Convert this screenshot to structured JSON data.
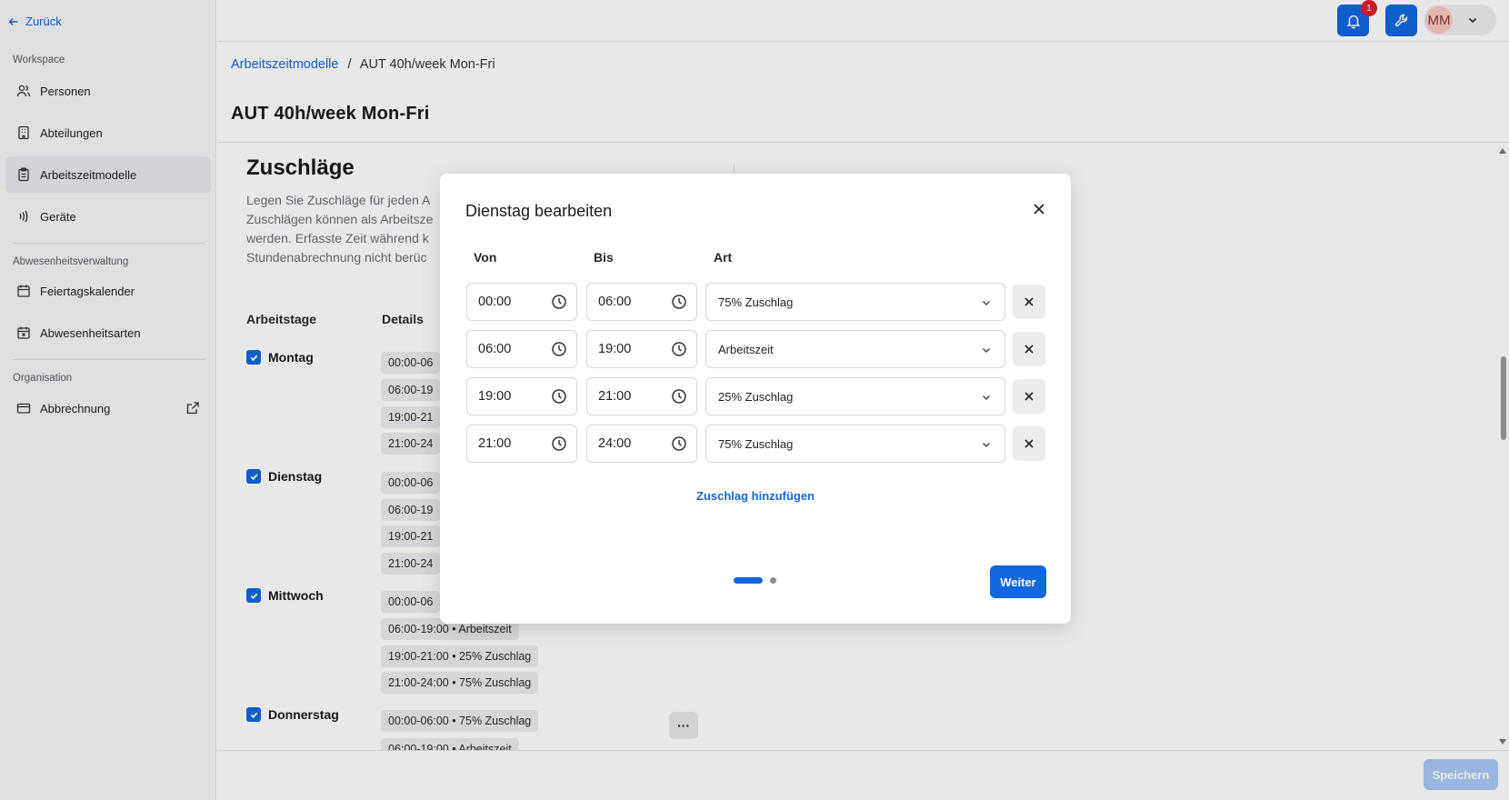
{
  "sidebar": {
    "back_label": "Zurück",
    "sections": [
      {
        "title": "Workspace"
      },
      {
        "title": "Abwesenheitsverwaltung"
      },
      {
        "title": "Organisation"
      }
    ],
    "items": [
      {
        "label": "Personen",
        "icon": "users-icon"
      },
      {
        "label": "Abteilungen",
        "icon": "building-icon"
      },
      {
        "label": "Arbeitszeitmodelle",
        "icon": "clipboard-icon",
        "active": true
      },
      {
        "label": "Geräte",
        "icon": "nfc-icon"
      },
      {
        "label": "Feiertagskalender",
        "icon": "calendar-icon"
      },
      {
        "label": "Abwesenheitsarten",
        "icon": "calendar-x-icon"
      },
      {
        "label": "Abbrechnung",
        "icon": "card-icon",
        "external": true
      }
    ]
  },
  "topbar": {
    "notification_count": "1",
    "avatar_initials": "MM"
  },
  "breadcrumb": {
    "parent": "Arbeitszeitmodelle",
    "separator": "/",
    "current": "AUT 40h/week Mon-Fri"
  },
  "page": {
    "title": "AUT 40h/week Mon-Fri",
    "section_title": "Zuschläge",
    "description_lines": [
      "Legen Sie Zuschläge für jeden A",
      "Zuschlägen können als Arbeitsze",
      "werden. Erfasste Zeit während k",
      "Stundenabrechnung nicht berüc"
    ],
    "table_headers": {
      "days": "Arbeitstage",
      "details": "Details"
    },
    "days": [
      {
        "name": "Montag",
        "chips": [
          "00:00-06",
          "06:00-19",
          "19:00-21",
          "21:00-24"
        ]
      },
      {
        "name": "Dienstag",
        "chips": [
          "00:00-06",
          "06:00-19",
          "19:00-21",
          "21:00-24"
        ]
      },
      {
        "name": "Mittwoch",
        "chips": [
          "00:00-06",
          "06:00-19:00 • Arbeitszeit",
          "19:00-21:00 • 25% Zuschlag",
          "21:00-24:00 • 75% Zuschlag"
        ]
      },
      {
        "name": "Donnerstag",
        "chips": [
          "00:00-06:00 • 75% Zuschlag",
          "06:00-19:00 • Arbeitszeit"
        ]
      }
    ],
    "more_label": "···"
  },
  "footer": {
    "save_label": "Speichern"
  },
  "modal": {
    "title": "Dienstag bearbeiten",
    "col_from": "Von",
    "col_to": "Bis",
    "col_type": "Art",
    "rows": [
      {
        "from": "00:00",
        "to": "06:00",
        "type": "75% Zuschlag"
      },
      {
        "from": "06:00",
        "to": "19:00",
        "type": "Arbeitszeit"
      },
      {
        "from": "19:00",
        "to": "21:00",
        "type": "25% Zuschlag"
      },
      {
        "from": "21:00",
        "to": "24:00",
        "type": "75% Zuschlag"
      }
    ],
    "add_label": "Zuschlag hinzufügen",
    "step_current": 1,
    "step_total": 2,
    "next_label": "Weiter"
  },
  "colors": {
    "accent": "#1167e0",
    "link": "#1565d8",
    "badge": "#e21b2a"
  }
}
